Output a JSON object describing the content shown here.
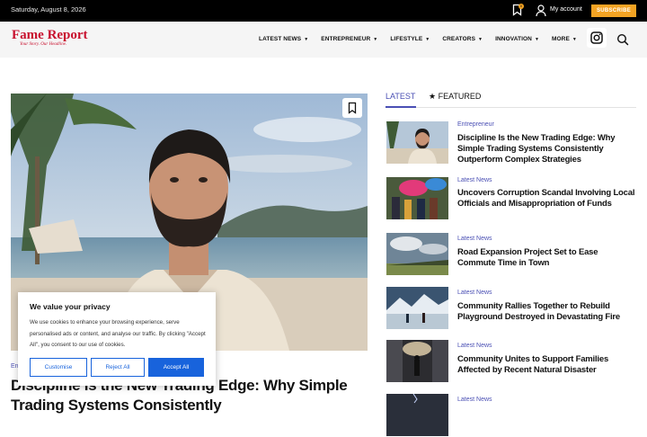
{
  "topbar": {
    "date": "Saturday, August 8, 2026",
    "notification_count": "0",
    "account_label": "My account",
    "subscribe_label": "SUBSCRIBE"
  },
  "brand": {
    "name": "Fame Report",
    "tagline": "Your Story. Our Headline.",
    "color": "#c8102e"
  },
  "nav": {
    "items": [
      {
        "label": "LATEST NEWS"
      },
      {
        "label": "ENTREPRENEUR"
      },
      {
        "label": "LIFESTYLE"
      },
      {
        "label": "CREATORS"
      },
      {
        "label": "INNOVATION"
      },
      {
        "label": "MORE"
      }
    ]
  },
  "hero": {
    "category": "Entrepreneur",
    "title": "Discipline Is the New Trading Edge: Why Simple Trading Systems Consistently"
  },
  "cookie": {
    "title": "We value your privacy",
    "message": "We use cookies to enhance your browsing experience, serve personalised ads or content, and analyse our traffic. By clicking \"Accept All\", you consent to our use of cookies.",
    "customise": "Customise",
    "reject": "Reject All",
    "accept": "Accept All",
    "accent": "#1863dc"
  },
  "sidebar": {
    "tabs": [
      {
        "label": "LATEST"
      },
      {
        "label": "FEATURED"
      }
    ],
    "items": [
      {
        "category": "Entrepreneur",
        "title": "Discipline Is the New Trading Edge: Why Simple Trading Systems Consistently Outperform Complex Strategies"
      },
      {
        "category": "Latest News",
        "title": "Uncovers Corruption Scandal Involving Local Officials and Misappropriation of Funds"
      },
      {
        "category": "Latest News",
        "title": "Road Expansion Project Set to Ease Commute Time in Town"
      },
      {
        "category": "Latest News",
        "title": "Community Rallies Together to Rebuild Playground Destroyed in Devastating Fire"
      },
      {
        "category": "Latest News",
        "title": "Community Unites to Support Families Affected by Recent Natural Disaster"
      },
      {
        "category": "Latest News",
        "title": ""
      }
    ]
  },
  "accent_color": "#4a4fb4"
}
